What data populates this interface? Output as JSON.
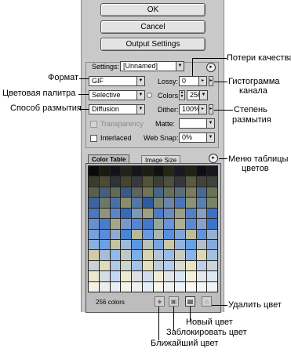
{
  "buttons": {
    "ok": "OK",
    "cancel": "Cancel",
    "output_settings": "Output Settings"
  },
  "settings": {
    "label": "Settings:",
    "value": "[Unnamed]"
  },
  "fields": {
    "format": "GIF",
    "palette": "Selective",
    "dither_method": "Diffusion",
    "transparency_label": "Transparency",
    "interlaced_label": "Interlaced",
    "lossy_label": "Lossy:",
    "lossy_value": "0",
    "colors_label": "Colors:",
    "colors_value": "256",
    "dither_label": "Dither:",
    "dither_value": "100%",
    "matte_label": "Matte:",
    "matte_value": "",
    "websnap_label": "Web Snap:",
    "websnap_value": "0%"
  },
  "tabs": {
    "color_table": "Color Table",
    "image_size": "Image Size"
  },
  "color_count": "256 colors",
  "annotations": {
    "format": "Формат",
    "palette": "Цветовая палитра",
    "dither_method": "Способ размытия",
    "lossy": "Потери качества",
    "histogram_line1": "Гистограмма",
    "histogram_line2": "канала",
    "dither_amount_line1": "Степень",
    "dither_amount_line2": "размытия",
    "table_menu_line1": "Меню таблицы",
    "table_menu_line2": "цветов",
    "delete_color": "Удалить цвет",
    "new_color": "Новый цвет",
    "lock_color": "Заблокировать цвет",
    "nearest_color": "Ближайший цвет"
  },
  "colors": {
    "panel": "#c9c9c9",
    "swatches": [
      "#0a0a0a",
      "#1a1a0e",
      "#101418",
      "#22241a",
      "#14161c",
      "#1c1e16",
      "#0e1012",
      "#262618",
      "#181a20",
      "#202214",
      "#0c0e10",
      "#16181c",
      "#3a3c2c",
      "#4a4c38",
      "#2e3436",
      "#444630",
      "#383a40",
      "#525438",
      "#3c4034",
      "#4e5040",
      "#34383a",
      "#585a42",
      "#42443a",
      "#3e4238",
      "#5a6050",
      "#44607c",
      "#626a58",
      "#3a5a86",
      "#5e6460",
      "#707458",
      "#48668a",
      "#66705c",
      "#5a6e7a",
      "#7a7c60",
      "#4c6a90",
      "#687256",
      "#3e64a0",
      "#6c7868",
      "#4a70a8",
      "#8a8c6a",
      "#5478a4",
      "#2e5aa0",
      "#7a8270",
      "#6a86a8",
      "#4c74b8",
      "#8e9278",
      "#5a80b0",
      "#788468",
      "#4878c0",
      "#90947a",
      "#5a86c8",
      "#3868b8",
      "#7c98b8",
      "#a0a080",
      "#4e7cc4",
      "#6c8cc0",
      "#9aa088",
      "#5480c8",
      "#88a0c0",
      "#4070c0",
      "#6890d0",
      "#4a7ccc",
      "#a4a68c",
      "#7898c8",
      "#5686d0",
      "#4278c8",
      "#98a4a0",
      "#6a94d4",
      "#b0b090",
      "#5c8ad0",
      "#86a2cc",
      "#3c74c8",
      "#7aa0d8",
      "#5a8cd8",
      "#92aad0",
      "#4a84d4",
      "#b8b898",
      "#6c98dc",
      "#a8b4b0",
      "#5890dc",
      "#80a4d8",
      "#c0bc98",
      "#6494d8",
      "#98b0d0",
      "#8ab0e0",
      "#6ca0e0",
      "#c4c2a0",
      "#a0b8d8",
      "#5c96e0",
      "#b8c0b8",
      "#78a6e0",
      "#ccc8a4",
      "#94b4dc",
      "#68a0e0",
      "#b0c0d0",
      "#84aae0",
      "#d0cca8",
      "#a8bcd8",
      "#90b8e8",
      "#c0c8c4",
      "#7cb0e8",
      "#d8d4b0",
      "#b8c4d4",
      "#98bce8",
      "#c8ccc0",
      "#88b4e8",
      "#dcd8b4",
      "#a4c0e0",
      "#c8d0d8",
      "#e0dcb8",
      "#b0c8e4",
      "#d0d4c8",
      "#a0c4ec",
      "#e4e0bc",
      "#c0ccd8",
      "#b4ccec",
      "#d8dccc",
      "#e8e4c0",
      "#bcd0e8",
      "#ccd4dc",
      "#e8e8d0",
      "#d4dce4",
      "#c4d8f0",
      "#ecead0",
      "#dce0e0",
      "#d0dcec",
      "#f0ecd4",
      "#e0e4e4",
      "#d8e4f0",
      "#f2f0dc",
      "#e4e8ec",
      "#dce6f0",
      "#f4f2e4",
      "#ecedec",
      "#e8eef4",
      "#f6f4e8",
      "#eef0f0",
      "#e4ecf4",
      "#f8f6ec",
      "#f0f2f2",
      "#ecf2f8",
      "#faf8f0",
      "#f4f6f6",
      "#f0f4f8"
    ]
  }
}
